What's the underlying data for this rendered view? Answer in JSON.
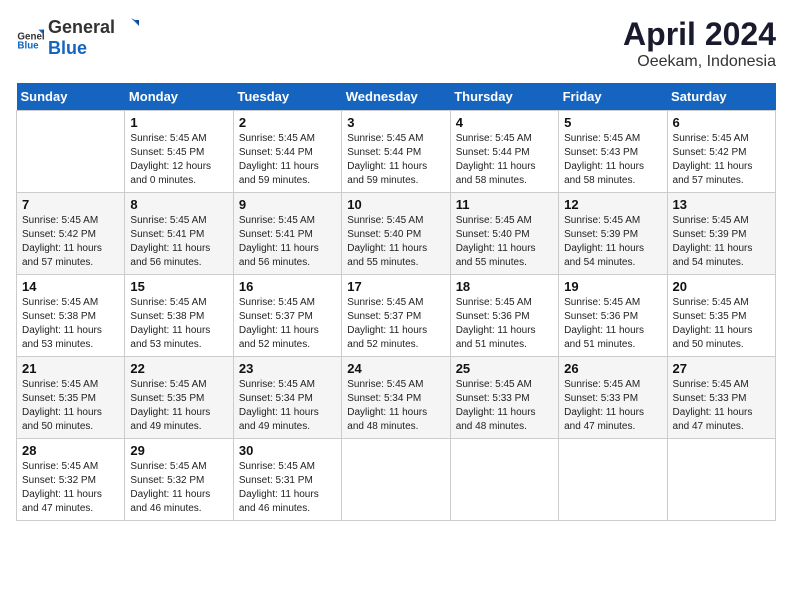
{
  "header": {
    "logo_general": "General",
    "logo_blue": "Blue",
    "title": "April 2024",
    "subtitle": "Oeekam, Indonesia"
  },
  "calendar": {
    "days_of_week": [
      "Sunday",
      "Monday",
      "Tuesday",
      "Wednesday",
      "Thursday",
      "Friday",
      "Saturday"
    ],
    "weeks": [
      [
        {
          "day": "",
          "empty": true
        },
        {
          "day": "1",
          "sunrise": "5:45 AM",
          "sunset": "5:45 PM",
          "daylight": "12 hours and 0 minutes."
        },
        {
          "day": "2",
          "sunrise": "5:45 AM",
          "sunset": "5:44 PM",
          "daylight": "11 hours and 59 minutes."
        },
        {
          "day": "3",
          "sunrise": "5:45 AM",
          "sunset": "5:44 PM",
          "daylight": "11 hours and 59 minutes."
        },
        {
          "day": "4",
          "sunrise": "5:45 AM",
          "sunset": "5:44 PM",
          "daylight": "11 hours and 58 minutes."
        },
        {
          "day": "5",
          "sunrise": "5:45 AM",
          "sunset": "5:43 PM",
          "daylight": "11 hours and 58 minutes."
        },
        {
          "day": "6",
          "sunrise": "5:45 AM",
          "sunset": "5:42 PM",
          "daylight": "11 hours and 57 minutes."
        }
      ],
      [
        {
          "day": "7",
          "sunrise": "5:45 AM",
          "sunset": "5:42 PM",
          "daylight": "11 hours and 57 minutes."
        },
        {
          "day": "8",
          "sunrise": "5:45 AM",
          "sunset": "5:41 PM",
          "daylight": "11 hours and 56 minutes."
        },
        {
          "day": "9",
          "sunrise": "5:45 AM",
          "sunset": "5:41 PM",
          "daylight": "11 hours and 56 minutes."
        },
        {
          "day": "10",
          "sunrise": "5:45 AM",
          "sunset": "5:40 PM",
          "daylight": "11 hours and 55 minutes."
        },
        {
          "day": "11",
          "sunrise": "5:45 AM",
          "sunset": "5:40 PM",
          "daylight": "11 hours and 55 minutes."
        },
        {
          "day": "12",
          "sunrise": "5:45 AM",
          "sunset": "5:39 PM",
          "daylight": "11 hours and 54 minutes."
        },
        {
          "day": "13",
          "sunrise": "5:45 AM",
          "sunset": "5:39 PM",
          "daylight": "11 hours and 54 minutes."
        }
      ],
      [
        {
          "day": "14",
          "sunrise": "5:45 AM",
          "sunset": "5:38 PM",
          "daylight": "11 hours and 53 minutes."
        },
        {
          "day": "15",
          "sunrise": "5:45 AM",
          "sunset": "5:38 PM",
          "daylight": "11 hours and 53 minutes."
        },
        {
          "day": "16",
          "sunrise": "5:45 AM",
          "sunset": "5:37 PM",
          "daylight": "11 hours and 52 minutes."
        },
        {
          "day": "17",
          "sunrise": "5:45 AM",
          "sunset": "5:37 PM",
          "daylight": "11 hours and 52 minutes."
        },
        {
          "day": "18",
          "sunrise": "5:45 AM",
          "sunset": "5:36 PM",
          "daylight": "11 hours and 51 minutes."
        },
        {
          "day": "19",
          "sunrise": "5:45 AM",
          "sunset": "5:36 PM",
          "daylight": "11 hours and 51 minutes."
        },
        {
          "day": "20",
          "sunrise": "5:45 AM",
          "sunset": "5:35 PM",
          "daylight": "11 hours and 50 minutes."
        }
      ],
      [
        {
          "day": "21",
          "sunrise": "5:45 AM",
          "sunset": "5:35 PM",
          "daylight": "11 hours and 50 minutes."
        },
        {
          "day": "22",
          "sunrise": "5:45 AM",
          "sunset": "5:35 PM",
          "daylight": "11 hours and 49 minutes."
        },
        {
          "day": "23",
          "sunrise": "5:45 AM",
          "sunset": "5:34 PM",
          "daylight": "11 hours and 49 minutes."
        },
        {
          "day": "24",
          "sunrise": "5:45 AM",
          "sunset": "5:34 PM",
          "daylight": "11 hours and 48 minutes."
        },
        {
          "day": "25",
          "sunrise": "5:45 AM",
          "sunset": "5:33 PM",
          "daylight": "11 hours and 48 minutes."
        },
        {
          "day": "26",
          "sunrise": "5:45 AM",
          "sunset": "5:33 PM",
          "daylight": "11 hours and 47 minutes."
        },
        {
          "day": "27",
          "sunrise": "5:45 AM",
          "sunset": "5:33 PM",
          "daylight": "11 hours and 47 minutes."
        }
      ],
      [
        {
          "day": "28",
          "sunrise": "5:45 AM",
          "sunset": "5:32 PM",
          "daylight": "11 hours and 47 minutes."
        },
        {
          "day": "29",
          "sunrise": "5:45 AM",
          "sunset": "5:32 PM",
          "daylight": "11 hours and 46 minutes."
        },
        {
          "day": "30",
          "sunrise": "5:45 AM",
          "sunset": "5:31 PM",
          "daylight": "11 hours and 46 minutes."
        },
        {
          "day": "",
          "empty": true
        },
        {
          "day": "",
          "empty": true
        },
        {
          "day": "",
          "empty": true
        },
        {
          "day": "",
          "empty": true
        }
      ]
    ]
  }
}
